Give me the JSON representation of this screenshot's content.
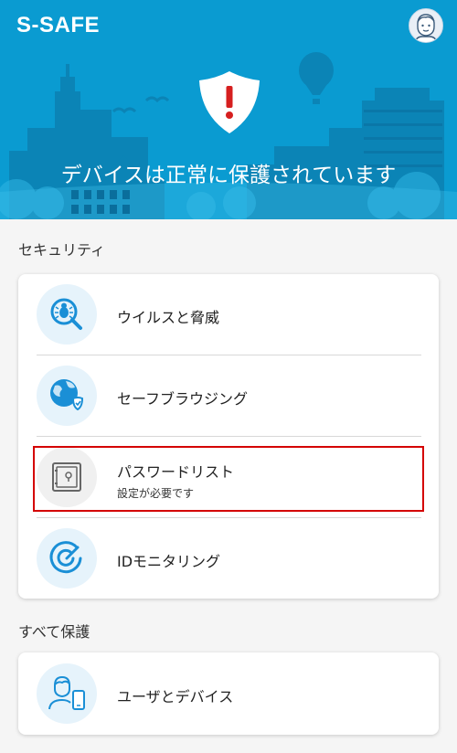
{
  "header": {
    "app_title": "S-SAFE",
    "status_text": "デバイスは正常に保護されています",
    "shield_icon": "alert-shield-icon",
    "avatar_icon": "user-avatar-icon"
  },
  "security": {
    "section_label": "セキュリティ",
    "items": [
      {
        "label": "ウイルスと脅威",
        "icon": "virus-search-icon"
      },
      {
        "label": "セーフブラウジング",
        "icon": "globe-shield-icon"
      },
      {
        "label": "パスワードリスト",
        "sublabel": "設定が必要です",
        "icon": "vault-icon"
      },
      {
        "label": "IDモニタリング",
        "icon": "radar-icon"
      }
    ]
  },
  "protect_all": {
    "section_label": "すべて保護",
    "items": [
      {
        "label": "ユーザとデバイス",
        "icon": "user-device-icon"
      }
    ]
  },
  "colors": {
    "hero_bg": "#0a9bd1",
    "icon_blue": "#1a8fd6",
    "highlight_border": "#d40000"
  }
}
